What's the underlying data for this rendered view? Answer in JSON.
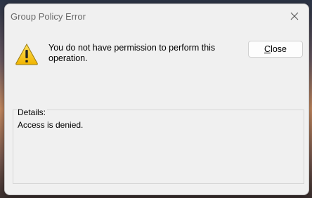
{
  "window": {
    "title": "Group Policy Error"
  },
  "message": {
    "text": "You do not have permission to perform this operation."
  },
  "buttons": {
    "close_pre": "",
    "close_mnemonic": "C",
    "close_rest": "lose"
  },
  "details": {
    "label": "Details:",
    "text": "Access is denied."
  },
  "icons": {
    "warning": "warning-icon",
    "close": "close-icon"
  },
  "colors": {
    "warning_fill": "#f2c40f",
    "dialog_bg": "#f0f0f0"
  }
}
